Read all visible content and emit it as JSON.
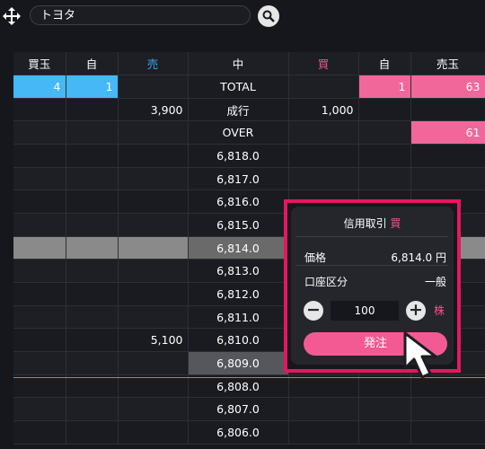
{
  "search": {
    "value": "トヨタ"
  },
  "board": {
    "headers": [
      "買玉",
      "自",
      "売",
      "中",
      "買",
      "自",
      "売玉"
    ],
    "rows": [
      [
        "4",
        "1",
        "",
        "TOTAL",
        "",
        "1",
        "63"
      ],
      [
        "",
        "",
        "3,900",
        "成行",
        "1,000",
        "",
        ""
      ],
      [
        "",
        "",
        "",
        "OVER",
        "",
        "",
        "61"
      ],
      [
        "",
        "",
        "",
        "6,818.0",
        "",
        "",
        ""
      ],
      [
        "",
        "",
        "",
        "6,817.0",
        "",
        "",
        ""
      ],
      [
        "",
        "",
        "",
        "6,816.0",
        "",
        "",
        ""
      ],
      [
        "",
        "",
        "",
        "6,815.0",
        "",
        "",
        ""
      ],
      [
        "",
        "",
        "",
        "6,814.0",
        "",
        "",
        ""
      ],
      [
        "",
        "",
        "",
        "6,813.0",
        "",
        "",
        ""
      ],
      [
        "",
        "",
        "",
        "6,812.0",
        "",
        "",
        ""
      ],
      [
        "",
        "",
        "",
        "6,811.0",
        "",
        "",
        ""
      ],
      [
        "",
        "",
        "5,100",
        "6,810.0",
        "",
        "",
        ""
      ],
      [
        "",
        "",
        "",
        "6,809.0",
        "",
        "",
        ""
      ],
      [
        "",
        "",
        "",
        "6,808.0",
        "",
        "",
        ""
      ],
      [
        "",
        "",
        "",
        "6,807.0",
        "",
        "",
        ""
      ],
      [
        "",
        "",
        "",
        "6,806.0",
        "",
        "",
        ""
      ]
    ]
  },
  "order_panel": {
    "title": "信用取引",
    "side": "買",
    "price_label": "価格",
    "price_value": "6,814.0 円",
    "account_label": "口座区分",
    "account_value": "一般",
    "quantity": "100",
    "unit": "株",
    "submit_label": "発注"
  },
  "colors": {
    "buy": "#f0548a",
    "sell": "#3aa3f0",
    "highlight": "#e5175f"
  }
}
